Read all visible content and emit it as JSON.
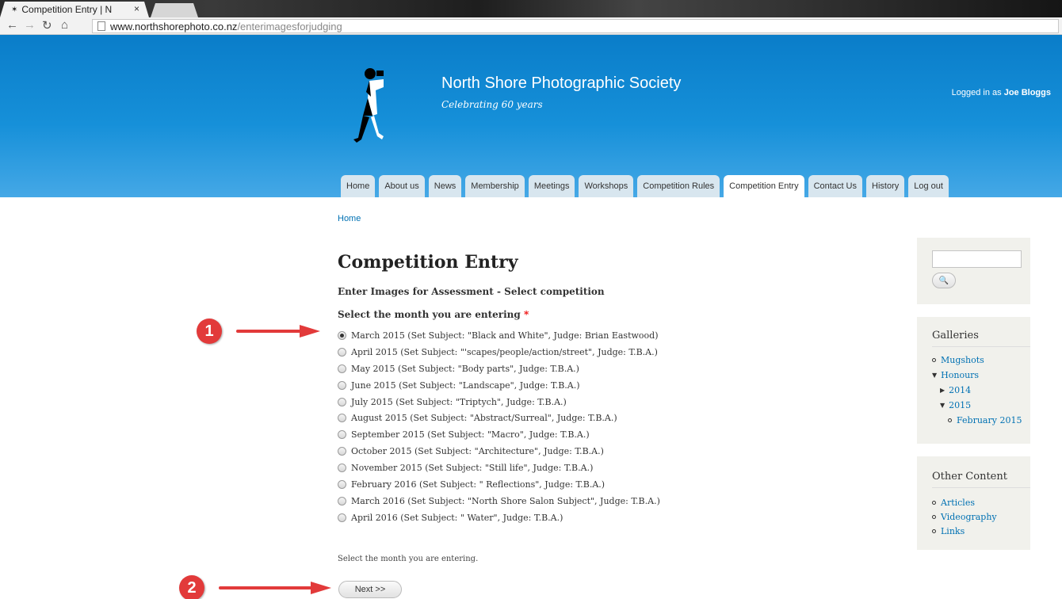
{
  "browser": {
    "tab_title": "Competition Entry | N",
    "tab_close": "×",
    "url_host": "www.northshorephoto.co.nz",
    "url_path": "/enterimagesforjudging"
  },
  "header": {
    "site_name": "North Shore Photographic Society",
    "slogan": "Celebrating 60 years",
    "logged_in_prefix": "Logged in as",
    "logged_in_user": "Joe Bloggs"
  },
  "menu": [
    {
      "label": "Home"
    },
    {
      "label": "About us"
    },
    {
      "label": "News"
    },
    {
      "label": "Membership"
    },
    {
      "label": "Meetings"
    },
    {
      "label": "Workshops"
    },
    {
      "label": "Competition Rules"
    },
    {
      "label": "Competition Entry"
    },
    {
      "label": "Contact Us"
    },
    {
      "label": "History"
    },
    {
      "label": "Log out"
    }
  ],
  "breadcrumb": "Home",
  "page": {
    "title": "Competition Entry",
    "subtitle": "Enter Images for Assessment - Select competition",
    "field_label": "Select the month you are entering",
    "required_mark": "*",
    "options": [
      "March 2015 (Set Subject: \"Black and White\",   Judge: Brian Eastwood)",
      "April 2015 (Set Subject: \"'scapes/people/action/street\",   Judge: T.B.A.)",
      "May 2015 (Set Subject: \"Body parts\",   Judge: T.B.A.)",
      "June 2015 (Set Subject: \"Landscape\",   Judge: T.B.A.)",
      "July 2015 (Set Subject: \"Triptych\",   Judge: T.B.A.)",
      "August 2015 (Set Subject: \"Abstract/Surreal\",   Judge: T.B.A.)",
      "September 2015 (Set Subject: \"Macro\",   Judge: T.B.A.)",
      "October 2015 (Set Subject: \"Architecture\",   Judge: T.B.A.)",
      "November 2015 (Set Subject: \"Still life\",   Judge: T.B.A.)",
      "February 2016 (Set Subject: \" Reflections\",   Judge: T.B.A.)",
      "March 2016 (Set Subject: \"North Shore Salon Subject\",   Judge: T.B.A.)",
      "April 2016 (Set Subject: \" Water\",   Judge: T.B.A.)"
    ],
    "selected_index": 0,
    "description": "Select the month you are entering.",
    "next_label": "Next >>"
  },
  "annotations": [
    "1",
    "2"
  ],
  "sidebar": {
    "search_button": "🔍",
    "galleries_title": "Galleries",
    "galleries": [
      "Mugshots",
      "Honours",
      "2014",
      "2015",
      "February 2015"
    ],
    "other_title": "Other Content",
    "other": [
      "Articles",
      "Videography",
      "Links"
    ]
  },
  "colors": {
    "header_blue": "#0a7dc9",
    "link_blue": "#0071b3",
    "annotation_red": "#e23a3a"
  }
}
